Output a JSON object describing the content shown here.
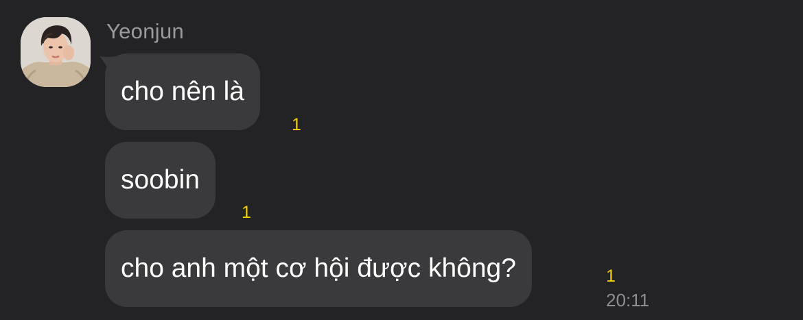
{
  "chat": {
    "sender_name": "Yeonjun",
    "avatar_icon": "profile-photo",
    "messages": [
      {
        "text": "cho nên là",
        "unread_count": "1"
      },
      {
        "text": "soobin",
        "unread_count": "1"
      },
      {
        "text": "cho anh một cơ hội được không?",
        "unread_count": "1",
        "time": "20:11"
      }
    ]
  },
  "colors": {
    "background": "#232325",
    "bubble": "#3a3a3c",
    "message_text": "#ffffff",
    "sender_name": "#9b9b9f",
    "unread_count": "#f2d200",
    "timestamp": "#8e8e93"
  }
}
